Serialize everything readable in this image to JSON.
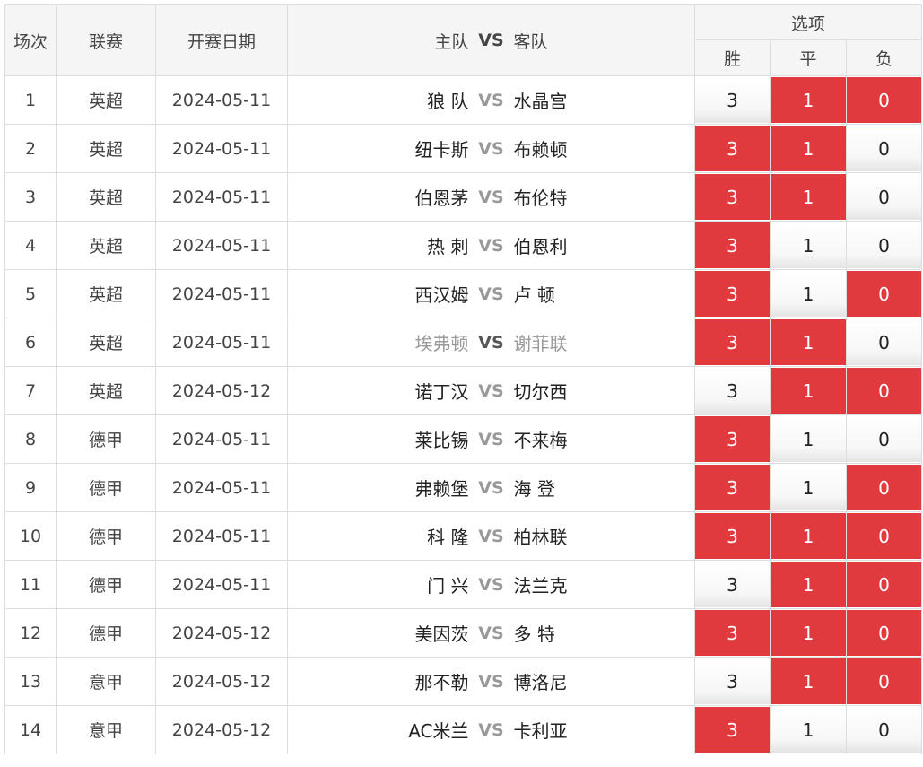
{
  "header": {
    "col_index": "场次",
    "col_league": "联赛",
    "col_date": "开赛日期",
    "col_home": "主队",
    "col_vs": "VS",
    "col_away": "客队",
    "col_options": "选项",
    "opt_win": "胜",
    "opt_draw": "平",
    "opt_lose": "负"
  },
  "colors": {
    "selected": "#e03a3e",
    "vs_text": "#999999"
  },
  "rows": [
    {
      "no": "1",
      "league": "英超",
      "date": "2024-05-11",
      "home": "狼 队",
      "vs": "VS",
      "away": "水晶宫",
      "win": "3",
      "draw": "1",
      "lose": "0",
      "win_sel": false,
      "draw_sel": true,
      "lose_sel": true,
      "dim": false
    },
    {
      "no": "2",
      "league": "英超",
      "date": "2024-05-11",
      "home": "纽卡斯",
      "vs": "VS",
      "away": "布赖顿",
      "win": "3",
      "draw": "1",
      "lose": "0",
      "win_sel": true,
      "draw_sel": true,
      "lose_sel": false,
      "dim": false
    },
    {
      "no": "3",
      "league": "英超",
      "date": "2024-05-11",
      "home": "伯恩茅",
      "vs": "VS",
      "away": "布伦特",
      "win": "3",
      "draw": "1",
      "lose": "0",
      "win_sel": true,
      "draw_sel": true,
      "lose_sel": false,
      "dim": false
    },
    {
      "no": "4",
      "league": "英超",
      "date": "2024-05-11",
      "home": "热 刺",
      "vs": "VS",
      "away": "伯恩利",
      "win": "3",
      "draw": "1",
      "lose": "0",
      "win_sel": true,
      "draw_sel": false,
      "lose_sel": false,
      "dim": false
    },
    {
      "no": "5",
      "league": "英超",
      "date": "2024-05-11",
      "home": "西汉姆",
      "vs": "VS",
      "away": "卢 顿",
      "win": "3",
      "draw": "1",
      "lose": "0",
      "win_sel": true,
      "draw_sel": false,
      "lose_sel": true,
      "dim": false
    },
    {
      "no": "6",
      "league": "英超",
      "date": "2024-05-11",
      "home": "埃弗顿",
      "vs": "VS",
      "away": "谢菲联",
      "win": "3",
      "draw": "1",
      "lose": "0",
      "win_sel": true,
      "draw_sel": true,
      "lose_sel": false,
      "dim": true
    },
    {
      "no": "7",
      "league": "英超",
      "date": "2024-05-12",
      "home": "诺丁汉",
      "vs": "VS",
      "away": "切尔西",
      "win": "3",
      "draw": "1",
      "lose": "0",
      "win_sel": false,
      "draw_sel": true,
      "lose_sel": true,
      "dim": false
    },
    {
      "no": "8",
      "league": "德甲",
      "date": "2024-05-11",
      "home": "莱比锡",
      "vs": "VS",
      "away": "不来梅",
      "win": "3",
      "draw": "1",
      "lose": "0",
      "win_sel": true,
      "draw_sel": false,
      "lose_sel": false,
      "dim": false
    },
    {
      "no": "9",
      "league": "德甲",
      "date": "2024-05-11",
      "home": "弗赖堡",
      "vs": "VS",
      "away": "海 登",
      "win": "3",
      "draw": "1",
      "lose": "0",
      "win_sel": true,
      "draw_sel": false,
      "lose_sel": true,
      "dim": false
    },
    {
      "no": "10",
      "league": "德甲",
      "date": "2024-05-11",
      "home": "科 隆",
      "vs": "VS",
      "away": "柏林联",
      "win": "3",
      "draw": "1",
      "lose": "0",
      "win_sel": true,
      "draw_sel": true,
      "lose_sel": true,
      "dim": false
    },
    {
      "no": "11",
      "league": "德甲",
      "date": "2024-05-11",
      "home": "门 兴",
      "vs": "VS",
      "away": "法兰克",
      "win": "3",
      "draw": "1",
      "lose": "0",
      "win_sel": false,
      "draw_sel": true,
      "lose_sel": true,
      "dim": false
    },
    {
      "no": "12",
      "league": "德甲",
      "date": "2024-05-12",
      "home": "美因茨",
      "vs": "VS",
      "away": "多 特",
      "win": "3",
      "draw": "1",
      "lose": "0",
      "win_sel": true,
      "draw_sel": true,
      "lose_sel": true,
      "dim": false
    },
    {
      "no": "13",
      "league": "意甲",
      "date": "2024-05-12",
      "home": "那不勒",
      "vs": "VS",
      "away": "博洛尼",
      "win": "3",
      "draw": "1",
      "lose": "0",
      "win_sel": false,
      "draw_sel": true,
      "lose_sel": true,
      "dim": false
    },
    {
      "no": "14",
      "league": "意甲",
      "date": "2024-05-12",
      "home": "AC米兰",
      "vs": "VS",
      "away": "卡利亚",
      "win": "3",
      "draw": "1",
      "lose": "0",
      "win_sel": true,
      "draw_sel": false,
      "lose_sel": false,
      "dim": false
    }
  ]
}
